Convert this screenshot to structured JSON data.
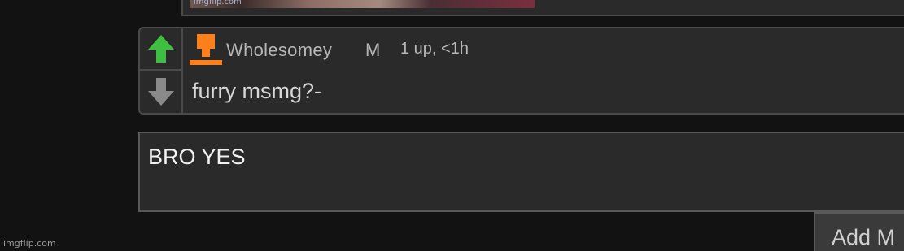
{
  "previous": {
    "image_watermark": "imgflip.com"
  },
  "comment": {
    "username": "Wholesomey",
    "gender": "M",
    "meta": "1 up, <1h",
    "text": "furry msmg?-",
    "user_icon": "orange-user-icon",
    "upvote_icon": "green-up-arrow-icon",
    "downvote_icon": "gray-down-arrow-icon",
    "colors": {
      "upvote": "#3fbf3f",
      "downvote": "#8a8a8a",
      "user_icon": "#ff7f1a"
    }
  },
  "reply": {
    "value": "BRO YES"
  },
  "add_button": {
    "label": "Add M"
  },
  "watermark": "imgflip.com"
}
